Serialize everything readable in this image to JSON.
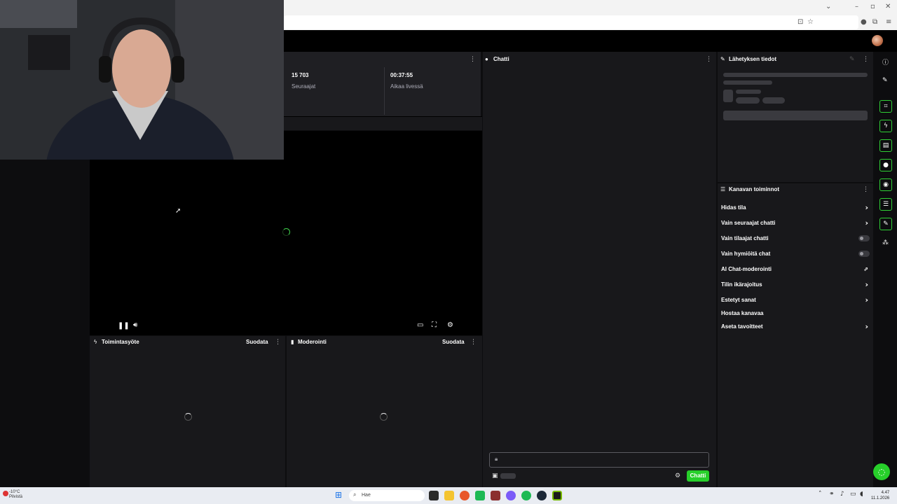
{
  "stats": {
    "followers_value": "15 703",
    "followers_label": "Seuraajat",
    "live_time_value": "00:37:55",
    "live_time_label": "Aikaa livessä"
  },
  "panels": {
    "activity": {
      "title": "Toimintasyöte",
      "filter": "Suodata"
    },
    "moderation": {
      "title": "Moderointi",
      "filter": "Suodata"
    },
    "chat": {
      "title": "Chatti",
      "send_label": "Chatti"
    },
    "stream_info": {
      "title": "Lähetyksen tiedot"
    },
    "channel_actions": {
      "title": "Kanavan toiminnot",
      "items": [
        {
          "label": "Hidas tila",
          "control": "chevron"
        },
        {
          "label": "Vain seuraajat chatti",
          "control": "chevron"
        },
        {
          "label": "Vain tilaajat chatti",
          "control": "toggle"
        },
        {
          "label": "Vain hymiöitä chat",
          "control": "toggle"
        },
        {
          "label": "AI Chat-moderointi",
          "control": "external"
        },
        {
          "label": "Tilin ikärajoitus",
          "control": "chevron"
        },
        {
          "label": "Estetyt sanat",
          "control": "chevron"
        },
        {
          "label": "Hostaa kanavaa",
          "control": "none"
        },
        {
          "label": "Aseta tavoitteet",
          "control": "chevron"
        }
      ]
    }
  },
  "taskbar": {
    "search_placeholder": "Hae",
    "weather_temp": "-10°C",
    "weather_desc": "Pilvistä",
    "time": "4.47",
    "date": "11.1.2026"
  },
  "colors": {
    "accent": "#27cf2a",
    "panel_bg": "#18181b",
    "page_bg": "#0d0d0f"
  }
}
